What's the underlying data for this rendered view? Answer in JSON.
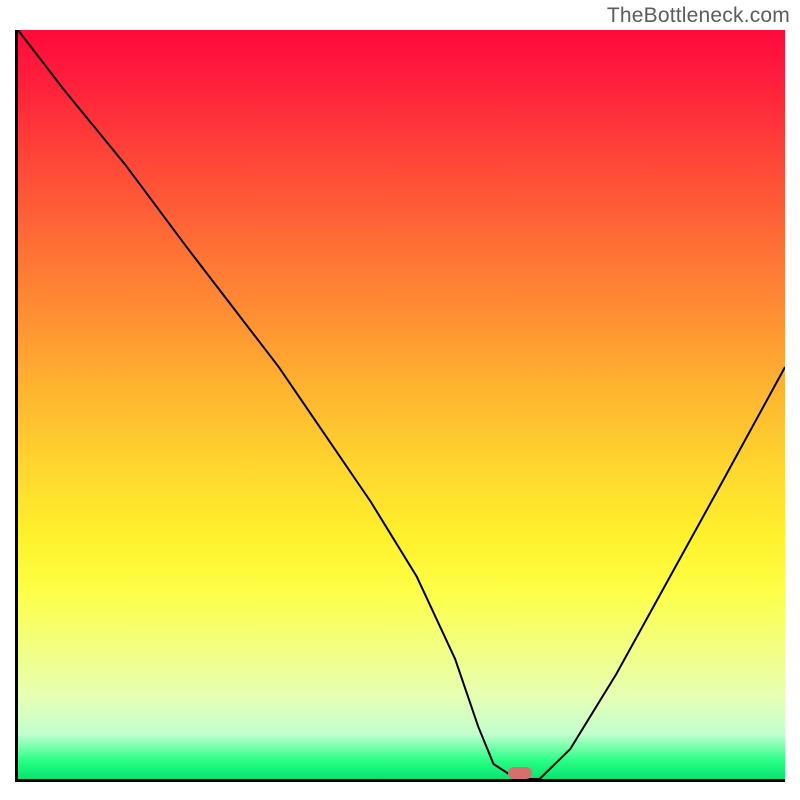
{
  "watermark": "TheBottleneck.com",
  "marker": {
    "x_pct": 65.5,
    "y_pct": 99.2
  },
  "chart_data": {
    "type": "line",
    "title": "",
    "xlabel": "",
    "ylabel": "",
    "xlim": [
      0,
      100
    ],
    "ylim": [
      0,
      100
    ],
    "grid": false,
    "series": [
      {
        "name": "curve",
        "x": [
          0,
          6,
          14,
          22,
          28,
          34,
          40,
          46,
          52,
          57,
          60,
          62,
          65,
          68,
          72,
          78,
          85,
          92,
          100
        ],
        "y": [
          100,
          92,
          82,
          71,
          63,
          55,
          46,
          37,
          27,
          16,
          7,
          2,
          0,
          0,
          4,
          14,
          27,
          40,
          55
        ]
      }
    ],
    "annotations": [
      {
        "type": "marker",
        "x": 65.5,
        "y": 0.8,
        "shape": "rounded-rect",
        "color": "#d6706f"
      }
    ],
    "background_gradient": {
      "direction": "vertical",
      "stops": [
        {
          "pct": 0,
          "color": "#ff0a3c"
        },
        {
          "pct": 50,
          "color": "#ffb430"
        },
        {
          "pct": 75,
          "color": "#fdff47"
        },
        {
          "pct": 97,
          "color": "#2aff86"
        },
        {
          "pct": 100,
          "color": "#07e46e"
        }
      ]
    }
  }
}
